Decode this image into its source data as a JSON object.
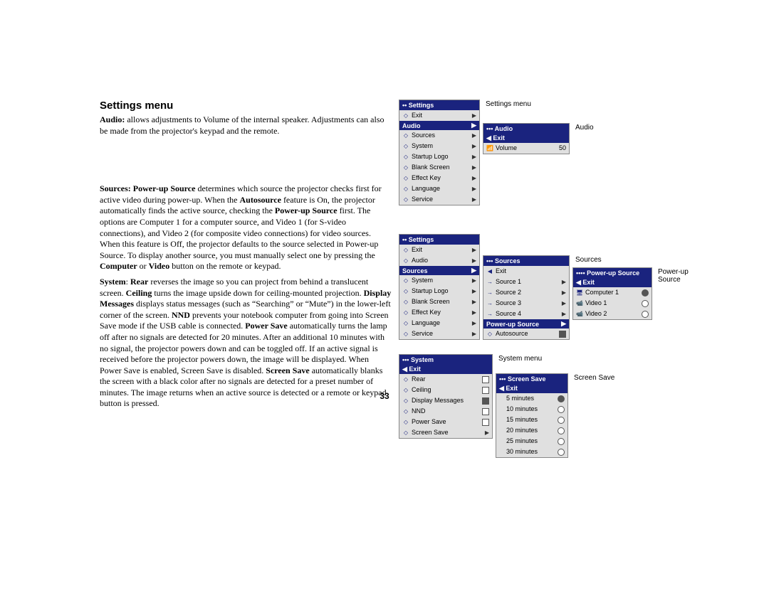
{
  "title": "Settings menu",
  "page_number": "33",
  "body": {
    "p1_pre": "Audio:",
    "p1_rest": " allows adjustments to Volume of the internal speaker. Adjustments can also be made from the projector's keypad and the remote.",
    "p2_a": "Sources: Power-up Source",
    "p2_b": " determines which source the projector checks first for active video during power-up. When the ",
    "p2_c": "Autosource",
    "p2_d": " feature is On, the projector automatically finds the active source, checking the ",
    "p2_e": "Power-up Source",
    "p2_f": " first. The options are Computer 1 for a computer source, and Video 1 (for S-video connections), and Video 2 (for composite video connections) for video sources. When this feature is Off, the projector defaults to the source selected in Power-up Source. To display another source, you must manually select one by pressing the ",
    "p2_g": "Computer",
    "p2_h": " or ",
    "p2_i": "Video",
    "p2_j": " button on the remote or keypad.",
    "p3_a": "System",
    "p3_b": ": ",
    "p3_c": "Rear",
    "p3_d": " reverses the image so you can project from behind a translucent screen. ",
    "p3_e": "Ceiling",
    "p3_f": " turns the image upside down for ceiling-mounted projection. ",
    "p3_g": "Display Messages",
    "p3_h": " displays status messages (such as “Searching” or “Mute”) in the lower-left corner of the screen. ",
    "p3_i": "NND",
    "p3_j": " prevents your notebook computer from going into Screen Save mode if the USB cable is connected. ",
    "p3_k": "Power Save",
    "p3_l": " automatically turns the lamp off after no signals are detected for 20 minutes. After an additional 10 minutes with no signal, the projector powers down and can be toggled off. If an active signal is received before the projector powers down, the image will be displayed. When Power Save is enabled, Screen Save is disabled. ",
    "p3_m": "Screen Save",
    "p3_n": " automatically blanks the screen with a black color after no signals are detected for a preset number of minutes. The image returns when an active source is detected or a remote or keypad button is pressed."
  },
  "captions": {
    "settings": "Settings menu",
    "audio": "Audio",
    "sources": "Sources",
    "powerup": "Power-up Source",
    "system": "System menu",
    "screensave": "Screen Save"
  },
  "menus": {
    "settings": {
      "title": "••  Settings",
      "items": [
        "Exit",
        "Audio",
        "Sources",
        "System",
        "Startup Logo",
        "Blank Screen",
        "Effect Key",
        "Language",
        "Service"
      ],
      "highlight": 1
    },
    "audio": {
      "title": "•••  Audio",
      "exit": "◀  Exit",
      "vol_label": "Volume",
      "vol_val": "50"
    },
    "settings2": {
      "title": "••  Settings",
      "items": [
        "Exit",
        "Audio",
        "Sources",
        "System",
        "Startup Logo",
        "Blank Screen",
        "Effect Key",
        "Language",
        "Service"
      ],
      "highlight": 2
    },
    "sources": {
      "title": "•••  Sources",
      "items": [
        "Exit",
        "Source 1",
        "Source 2",
        "Source 3",
        "Source 4",
        "Power-up Source",
        "Autosource"
      ],
      "highlight": 5
    },
    "powerup": {
      "title": "••••  Power-up Source",
      "exit": "◀  Exit",
      "items": [
        "Computer 1",
        "Video 1",
        "Video 2"
      ]
    },
    "system": {
      "title": "•••  System",
      "exit": "◀  Exit",
      "items": [
        "Rear",
        "Ceiling",
        "Display Messages",
        "NND",
        "Power Save",
        "Screen Save"
      ]
    },
    "screensave": {
      "title": "•••  Screen Save",
      "exit": "◀  Exit",
      "items": [
        "5 minutes",
        "10 minutes",
        "15 minutes",
        "20 minutes",
        "25 minutes",
        "30 minutes"
      ]
    }
  }
}
